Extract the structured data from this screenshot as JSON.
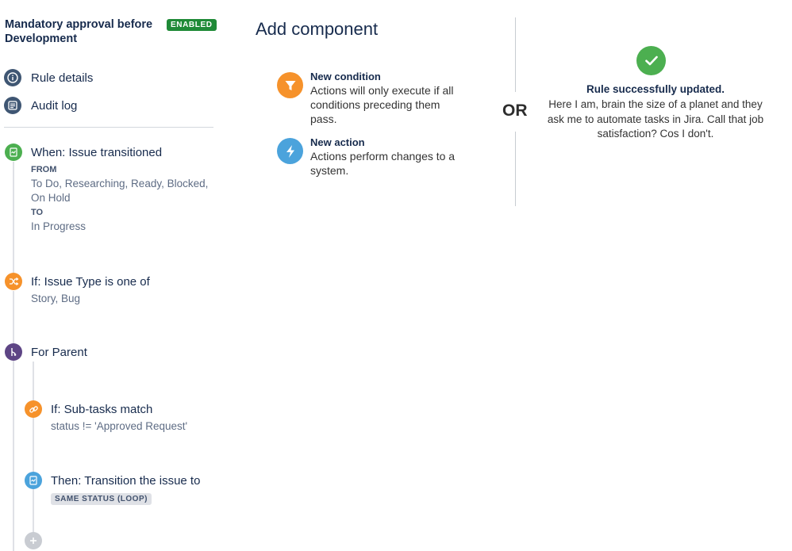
{
  "sidebar": {
    "rule_title": "Mandatory approval before Development",
    "status_badge": "ENABLED",
    "menu": [
      {
        "label": "Rule details",
        "icon": "info-icon"
      },
      {
        "label": "Audit log",
        "icon": "list-icon"
      }
    ]
  },
  "flow": {
    "trigger": {
      "title": "When: Issue transitioned",
      "from_label": "FROM",
      "from_value": "To Do, Researching, Ready, Blocked, On Hold",
      "to_label": "TO",
      "to_value": "In Progress"
    },
    "condition": {
      "title": "If: Issue Type is one of",
      "value": "Story, Bug"
    },
    "branch": {
      "title": "For Parent"
    },
    "sub_condition": {
      "title": "If: Sub-tasks match",
      "value": "status != 'Approved Request'"
    },
    "action": {
      "title": "Then: Transition the issue to",
      "badge": "SAME STATUS (LOOP)"
    }
  },
  "add_component": {
    "title": "Add component",
    "condition": {
      "title": "New condition",
      "desc": "Actions will only execute if all conditions preceding them pass."
    },
    "action": {
      "title": "New action",
      "desc": "Actions perform changes to a system."
    },
    "or_text": "OR"
  },
  "success": {
    "title": "Rule successfully updated.",
    "message": "Here I am, brain the size of a planet and they ask me to automate tasks in Jira. Call that job satisfaction? Cos I don't."
  },
  "colors": {
    "enabled": "#1f8a37",
    "trigger": "#4caf50",
    "condition": "#f6922b",
    "branch": "#5e4585",
    "action": "#4ba3dc"
  }
}
